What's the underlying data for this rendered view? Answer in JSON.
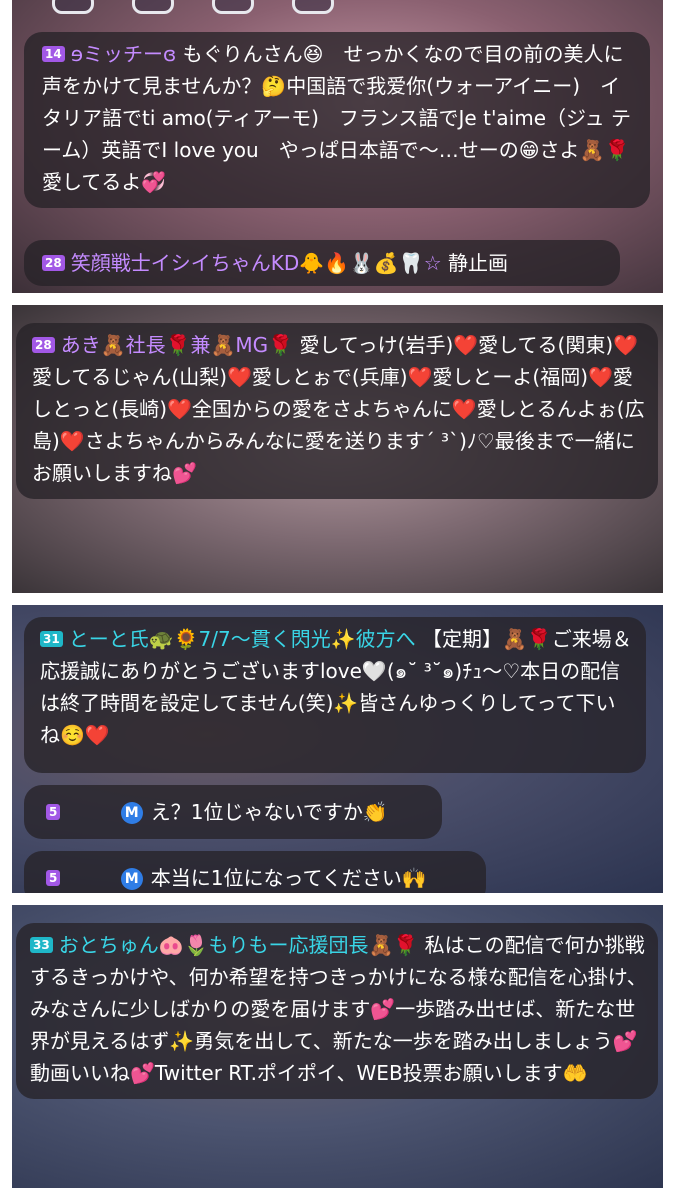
{
  "panel1": {
    "comment1": {
      "level": "14",
      "user": "ɘミッチーɞ",
      "text": "もぐりんさん😆　せっかくなので目の前の美人に声をかけて見ませんか？🤔中国語で我爱你(ウォーアイニー)　イタリア語でti amo(ティアーモ)　フランス語でJe t'aime（ジュ テーム）英語でI love you　やっぱ日本語で〜…せーの😁さよ🧸🌹愛してるよ💞"
    },
    "comment2": {
      "level": "28",
      "user": "笑顔戦士イシイちゃんKD🐥🔥🐰💰🦷☆",
      "text": "静止画"
    }
  },
  "panel2": {
    "comment1": {
      "level": "28",
      "user": "あき🧸社長🌹兼🧸MG🌹",
      "text": "愛してっけ(岩手)❤️愛してる(関東)❤️愛してるじゃん(山梨)❤️愛しとぉで(兵庫)❤️愛しとーよ(福岡)❤️愛しとっと(長崎)❤️全国からの愛をさよちゃんに❤️愛しとるんよぉ(広島)❤️さよちゃんからみんなに愛を送ります´ ³`)ﾉ♡最後まで一緒にお願いしますね💕"
    }
  },
  "panel3": {
    "comment1": {
      "level": "31",
      "user": "とーと氏🐢🌻7/7〜貫く閃光✨彼方へ",
      "text": "【定期】🧸🌹ご来場＆応援誠にありがとうございますlove🤍(๑˘ ³˘๑)ﾁｭ〜♡本日の配信は終了時間を設定してません(笑)✨皆さんゆっくりしてって下いね☺️❤️"
    },
    "comment2": {
      "level": "5",
      "m": "M",
      "text": "え？1位じゃないですか👏"
    },
    "comment3": {
      "level": "5",
      "m": "M",
      "text": "本当に1位になってください🙌"
    }
  },
  "panel4": {
    "comment1": {
      "level": "33",
      "user": "おとちゅん🐽🌷もりもー応援団長🧸🌹",
      "text": "私はこの配信で何か挑戦するきっかけや、何か希望を持つきっかけになる様な配信を心掛け、みなさんに少しばかりの愛を届けます💕一歩踏み出せば、新たな世界が見えるはず✨勇気を出して、新たな一歩を踏み出しましょう💕動画いいね💕Twitter  RT.ポイポイ、WEB投票お願いします🤲"
    }
  },
  "colors": {
    "username_purple": "#c48bff",
    "username_teal": "#39d5e6",
    "badge_purple": "#a258e6",
    "badge_teal": "#1fb7c8",
    "badge_m": "#2f7de6"
  }
}
